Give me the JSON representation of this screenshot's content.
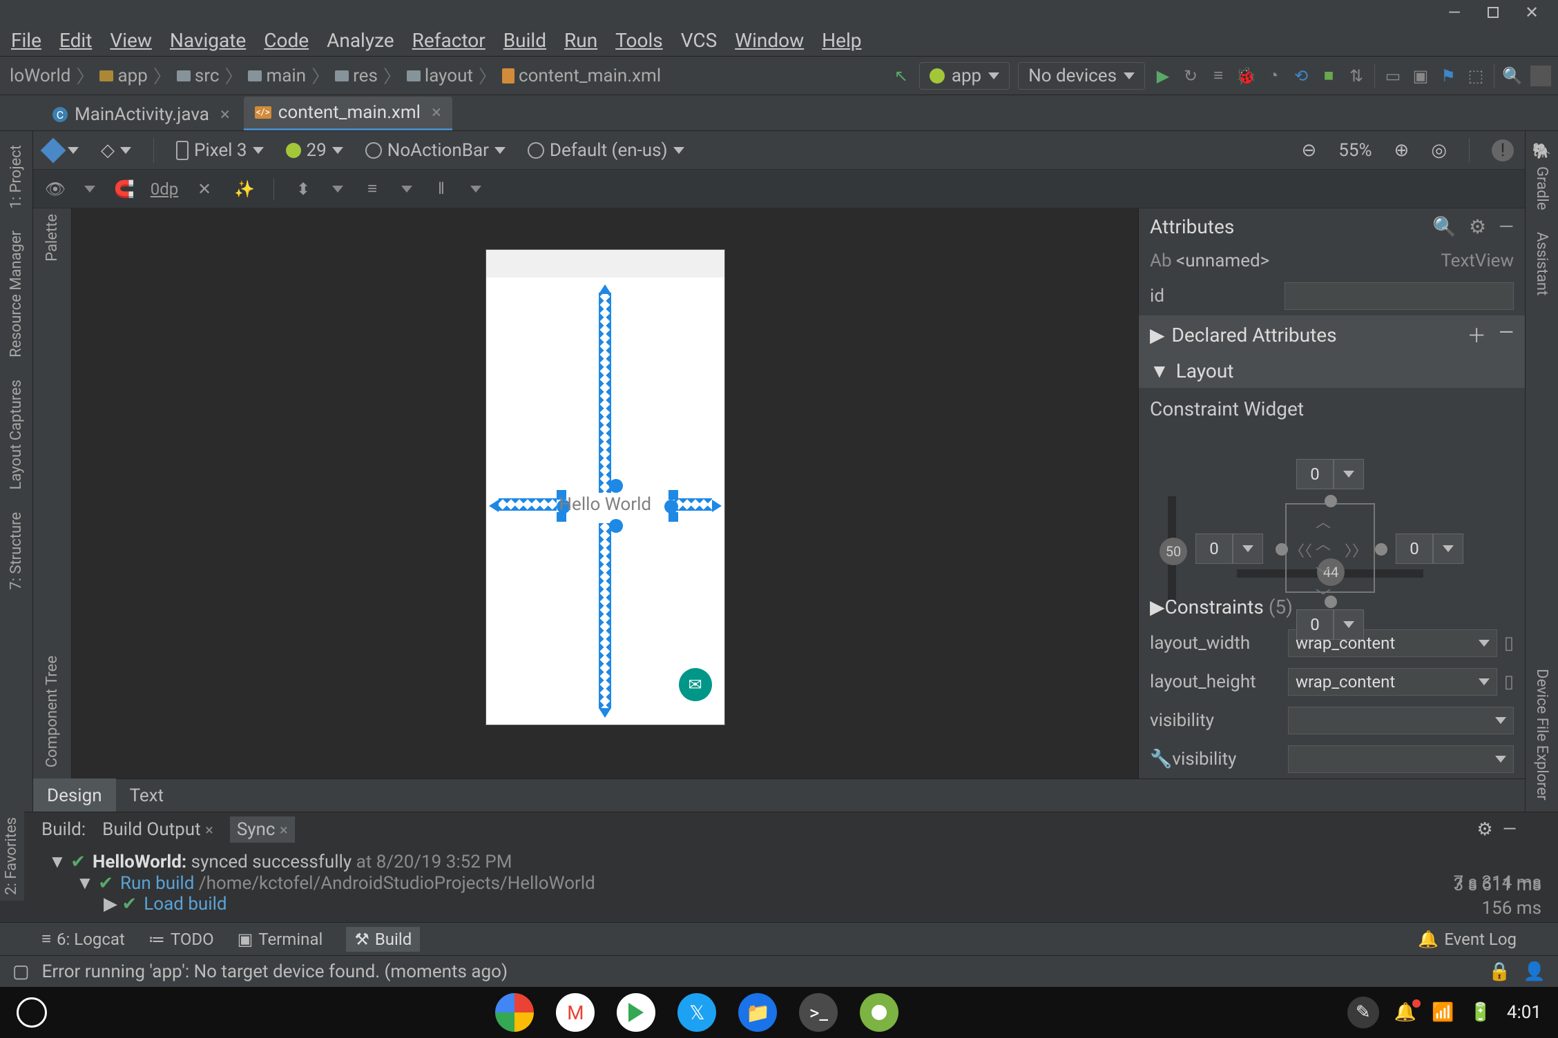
{
  "window": {
    "minimize": "—",
    "maximize": "▢",
    "close": "✕"
  },
  "menu": [
    "File",
    "Edit",
    "View",
    "Navigate",
    "Code",
    "Analyze",
    "Refactor",
    "Build",
    "Run",
    "Tools",
    "VCS",
    "Window",
    "Help"
  ],
  "breadcrumbs": [
    {
      "label": "loWorld",
      "icon": "module"
    },
    {
      "label": "app",
      "icon": "module"
    },
    {
      "label": "src",
      "icon": "folder"
    },
    {
      "label": "main",
      "icon": "folder"
    },
    {
      "label": "res",
      "icon": "folder"
    },
    {
      "label": "layout",
      "icon": "folder"
    },
    {
      "label": "content_main.xml",
      "icon": "file"
    }
  ],
  "runconfig": {
    "module": "app",
    "device": "No devices"
  },
  "tabs": [
    {
      "label": "MainActivity.java",
      "active": false,
      "badge": "C"
    },
    {
      "label": "content_main.xml",
      "active": true,
      "badge": "</>"
    }
  ],
  "left_gutter": [
    "1: Project",
    "Resource Manager",
    "Layout Captures",
    "7: Structure"
  ],
  "right_gutter": [
    "Gradle",
    "Assistant",
    "Device File Explorer"
  ],
  "palette_gutter": [
    "Palette",
    "Component Tree"
  ],
  "design_toolbar": {
    "device": "Pixel 3",
    "api": "29",
    "theme": "NoActionBar",
    "locale": "Default (en-us)",
    "zoom": "55%"
  },
  "design_toolbar2": {
    "margin": "0dp"
  },
  "design_tabs": [
    "Design",
    "Text"
  ],
  "canvas": {
    "text": "Hello World"
  },
  "attributes": {
    "title": "Attributes",
    "element_id": "<unnamed>",
    "element_type": "TextView",
    "element_prefix": "Ab",
    "id_label": "id",
    "id_value": "",
    "sections": {
      "declared": "Declared Attributes",
      "layout": "Layout",
      "constraints_label": "Constraints",
      "constraints_count": "(5)"
    },
    "widget_title": "Constraint Widget",
    "widget": {
      "top": "0",
      "bottom": "0",
      "left": "0",
      "right": "0",
      "badge_left": "50",
      "badge_bottom": "44"
    },
    "rows": [
      {
        "label": "layout_width",
        "value": "wrap_content"
      },
      {
        "label": "layout_height",
        "value": "wrap_content"
      },
      {
        "label": "visibility",
        "value": ""
      },
      {
        "label": "visibility",
        "value": "",
        "tools": true
      }
    ]
  },
  "build": {
    "header": "Build:",
    "tabs": [
      {
        "label": "Build Output",
        "active": false
      },
      {
        "label": "Sync",
        "active": true
      }
    ],
    "line1_project": "HelloWorld:",
    "line1_msg": "synced successfully",
    "line1_time": "at 8/20/19 3:52 PM",
    "t1": "7 s 314 ms",
    "line2": "Run build",
    "line2_path": "/home/kctofel/AndroidStudioProjects/HelloWorld",
    "t2": "3 s 611 ms",
    "line3": "Load build",
    "t3": "156 ms"
  },
  "footer_tools": [
    {
      "pre": "≡",
      "label": "6: Logcat"
    },
    {
      "pre": "≔",
      "label": "TODO"
    },
    {
      "pre": "▣",
      "label": "Terminal"
    },
    {
      "pre": "⚒",
      "label": "Build",
      "active": true
    }
  ],
  "event_log": "Event Log",
  "status": "Error running 'app': No target device found. (moments ago)",
  "favorites_label": "2: Favorites",
  "taskbar": {
    "time": "4:01",
    "apps": [
      {
        "name": "chrome",
        "color": "#ffffff"
      },
      {
        "name": "gmail",
        "color": "#ffffff"
      },
      {
        "name": "play",
        "color": "#ffffff"
      },
      {
        "name": "twitter",
        "color": "#1da1f2"
      },
      {
        "name": "files",
        "color": "#1a73e8"
      },
      {
        "name": "terminal",
        "color": "#4a4a4a"
      },
      {
        "name": "android-studio",
        "color": "#7cb342"
      }
    ]
  }
}
